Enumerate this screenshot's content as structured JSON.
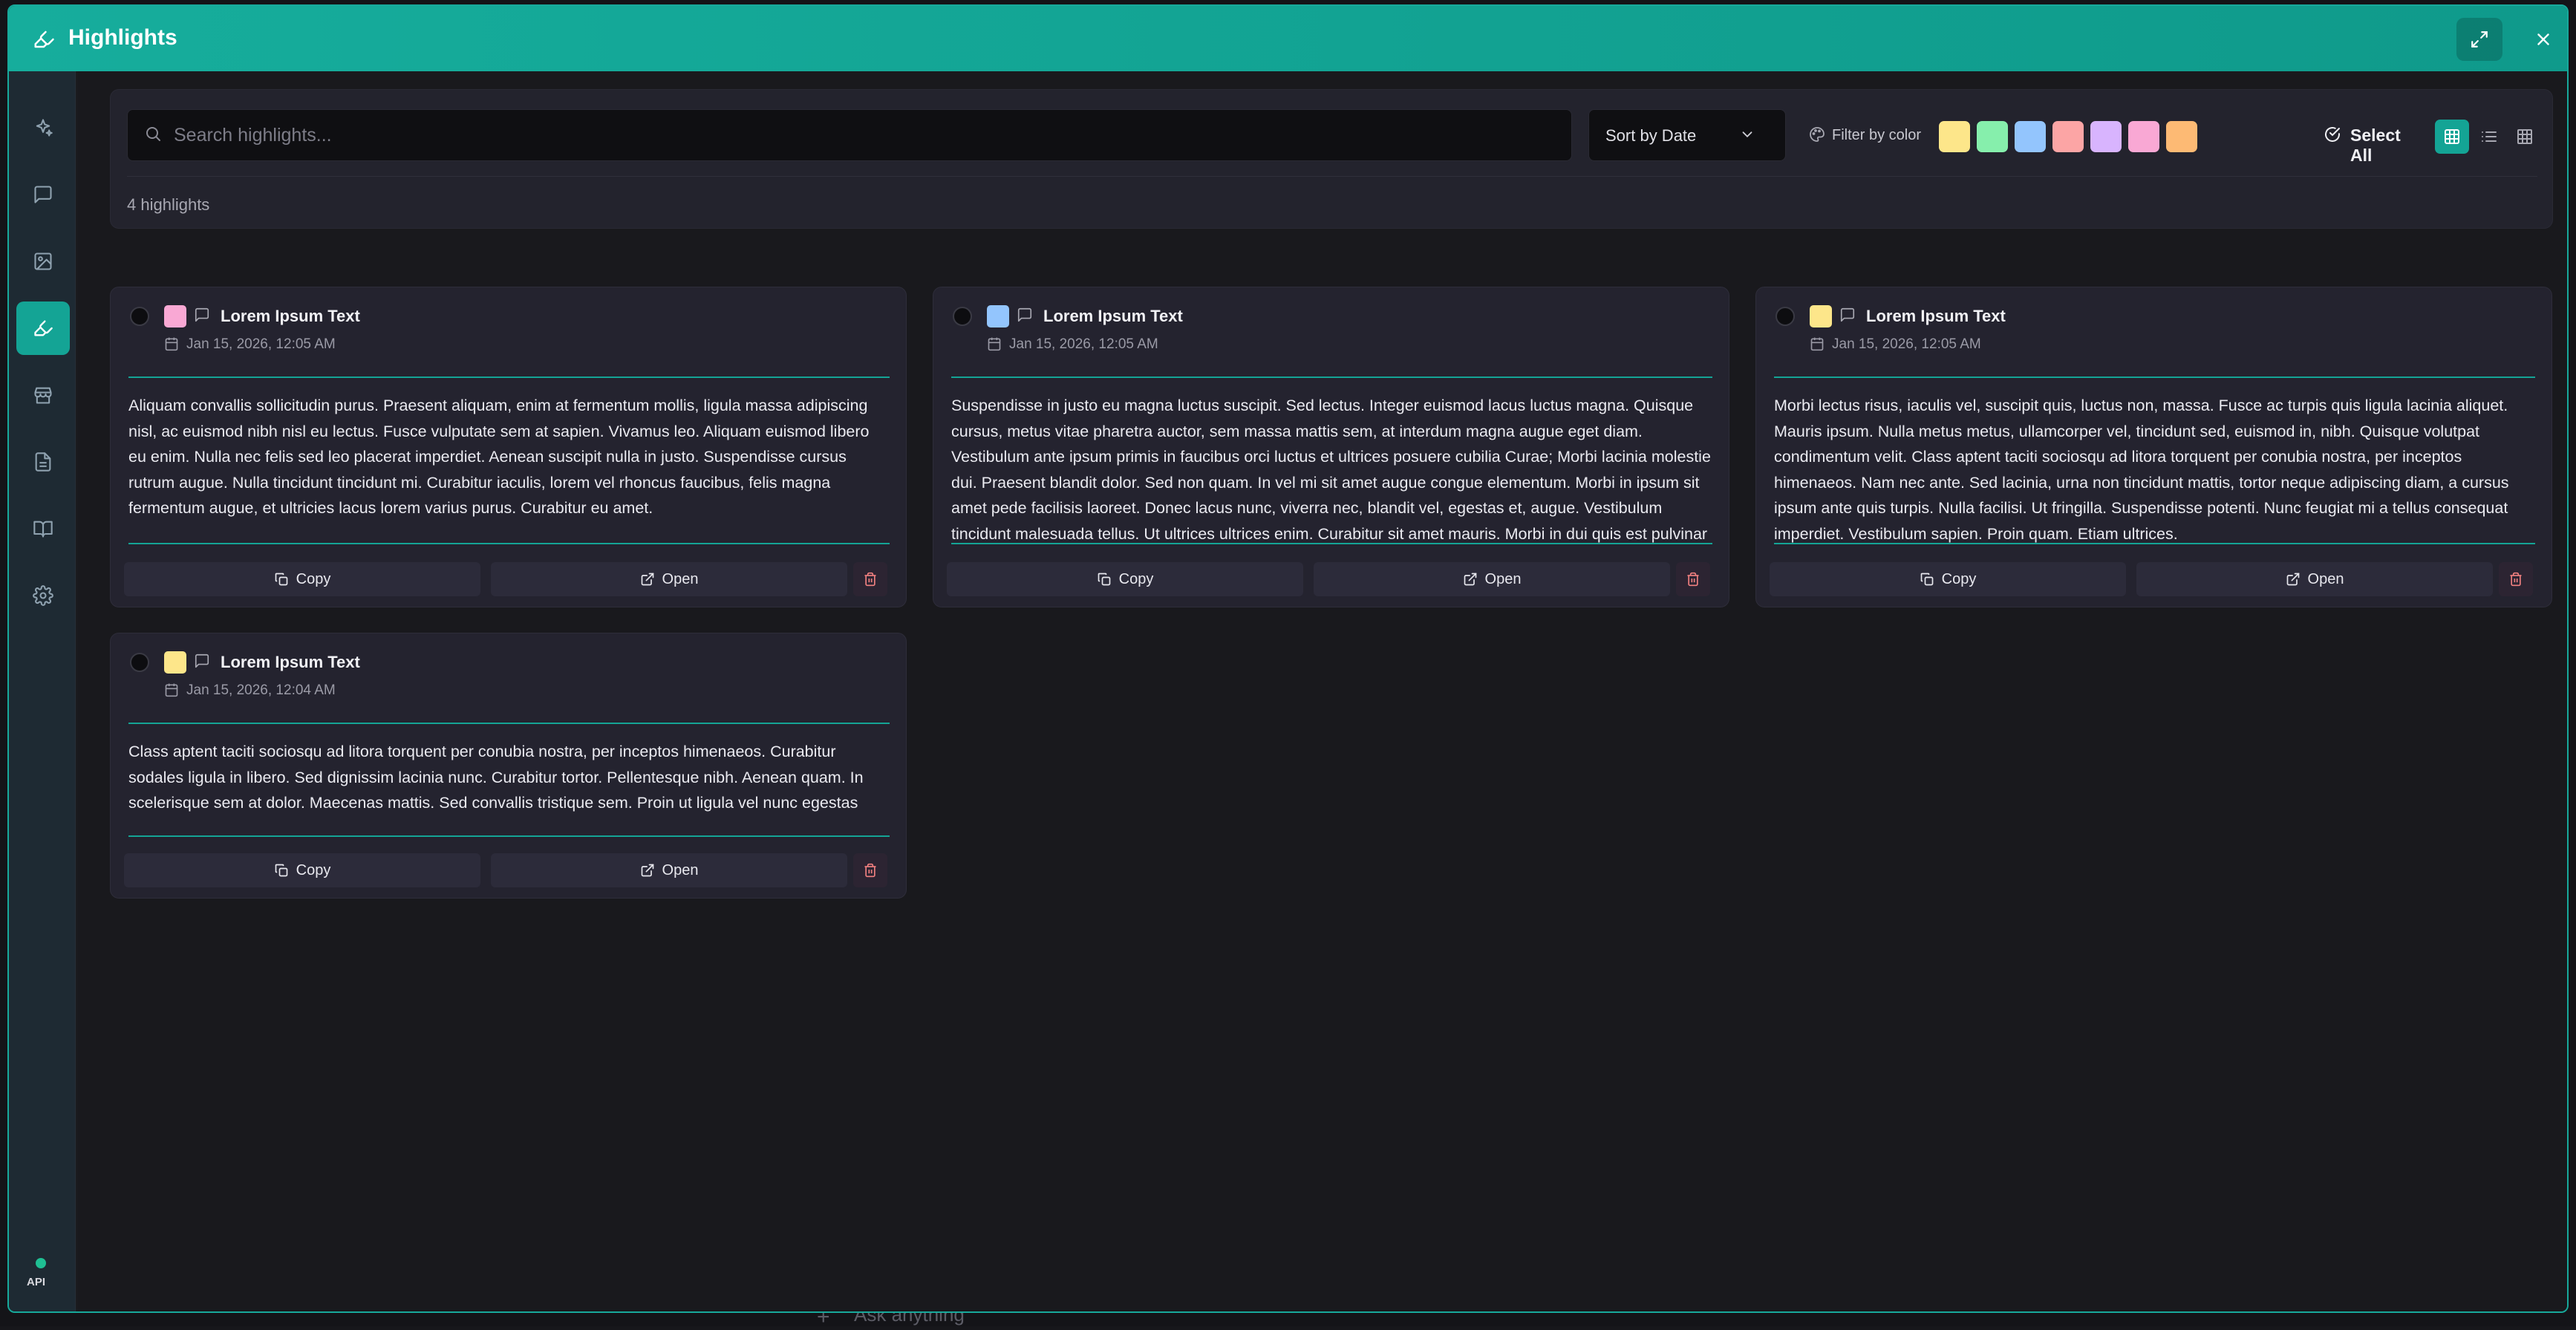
{
  "window": {
    "title": "Highlights"
  },
  "background": {
    "prompt_placeholder": "Ask anything"
  },
  "sidebar": {
    "items": [
      {
        "name": "sparkles-icon"
      },
      {
        "name": "chat-icon"
      },
      {
        "name": "image-icon"
      },
      {
        "name": "highlighter-icon",
        "active": true
      },
      {
        "name": "store-icon"
      },
      {
        "name": "document-icon"
      },
      {
        "name": "book-icon"
      },
      {
        "name": "gear-icon"
      }
    ],
    "status_label": "API",
    "status_color": "#1fbf93"
  },
  "toolbar": {
    "search_placeholder": "Search highlights...",
    "sort_label": "Sort by Date",
    "filter_label": "Filter by color",
    "swatches": [
      "#fde68a",
      "#86efac",
      "#93c5fd",
      "#fca5a5",
      "#d8b4fe",
      "#f9a8d4",
      "#fdba74"
    ],
    "select_all_label": "Select All",
    "accent_color": "#14a495",
    "count_text": "4 highlights"
  },
  "cards": [
    {
      "color": "#f9a8d4",
      "title": "Lorem Ipsum Text",
      "date": "Jan 15, 2026, 12:05 AM",
      "body": "Aliquam convallis sollicitudin purus. Praesent aliquam, enim at fermentum mollis, ligula massa adipiscing nisl, ac euismod nibh nisl eu lectus. Fusce vulputate sem at sapien. Vivamus leo. Aliquam euismod libero eu enim. Nulla nec felis sed leo placerat imperdiet. Aenean suscipit nulla in justo. Suspendisse cursus rutrum augue. Nulla tincidunt tincidunt mi. Curabitur iaculis, lorem vel rhoncus faucibus, felis magna fermentum augue, et ultricies lacus lorem varius purus. Curabitur eu amet.",
      "copy_label": "Copy",
      "open_label": "Open"
    },
    {
      "color": "#93c5fd",
      "title": "Lorem Ipsum Text",
      "date": "Jan 15, 2026, 12:05 AM",
      "body": "Suspendisse in justo eu magna luctus suscipit. Sed lectus. Integer euismod lacus luctus magna. Quisque cursus, metus vitae pharetra auctor, sem massa mattis sem, at interdum magna augue eget diam. Vestibulum ante ipsum primis in faucibus orci luctus et ultrices posuere cubilia Curae; Morbi lacinia molestie dui. Praesent blandit dolor. Sed non quam. In vel mi sit amet augue congue elementum. Morbi in ipsum sit amet pede facilisis laoreet. Donec lacus nunc, viverra nec, blandit vel, egestas et, augue. Vestibulum tincidunt malesuada tellus. Ut ultrices ultrices enim. Curabitur sit amet mauris. Morbi in dui quis est pulvinar ullamcorper. Nulla...",
      "copy_label": "Copy",
      "open_label": "Open"
    },
    {
      "color": "#fde68a",
      "title": "Lorem Ipsum Text",
      "date": "Jan 15, 2026, 12:05 AM",
      "body": "Morbi lectus risus, iaculis vel, suscipit quis, luctus non, massa. Fusce ac turpis quis ligula lacinia aliquet. Mauris ipsum. Nulla metus metus, ullamcorper vel, tincidunt sed, euismod in, nibh. Quisque volutpat condimentum velit. Class aptent taciti sociosqu ad litora torquent per conubia nostra, per inceptos himenaeos. Nam nec ante. Sed lacinia, urna non tincidunt mattis, tortor neque adipiscing diam, a cursus ipsum ante quis turpis. Nulla facilisi. Ut fringilla. Suspendisse potenti. Nunc feugiat mi a tellus consequat imperdiet. Vestibulum sapien. Proin quam. Etiam ultrices.",
      "copy_label": "Copy",
      "open_label": "Open"
    },
    {
      "color": "#fde68a",
      "title": "Lorem Ipsum Text",
      "date": "Jan 15, 2026, 12:04 AM",
      "body": "Class aptent taciti sociosqu ad litora torquent per conubia nostra, per inceptos himenaeos. Curabitur sodales ligula in libero. Sed dignissim lacinia nunc. Curabitur tortor. Pellentesque nibh. Aenean quam. In scelerisque sem at dolor. Maecenas mattis. Sed convallis tristique sem. Proin ut ligula vel nunc egestas porttitor.",
      "copy_label": "Copy",
      "open_label": "Open"
    }
  ]
}
